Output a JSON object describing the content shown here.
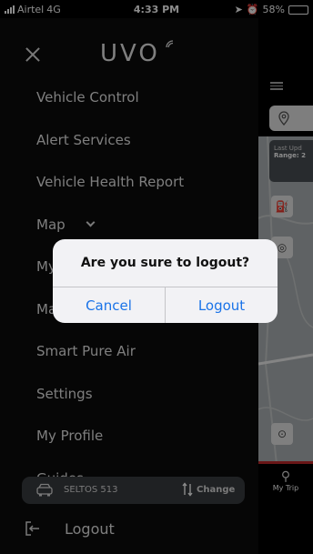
{
  "status_bar": {
    "carrier": "Airtel",
    "network": "4G",
    "time": "4:33 PM",
    "battery": "58%",
    "battery_level": 0.58
  },
  "header": {
    "logo_text": "UVO"
  },
  "menu": {
    "items": [
      {
        "label": "Vehicle Control"
      },
      {
        "label": "Alert Services"
      },
      {
        "label": "Vehicle Health Report"
      },
      {
        "label": "Map"
      },
      {
        "label": "My Trips"
      },
      {
        "label": "Manuals"
      },
      {
        "label": "Smart Pure Air"
      },
      {
        "label": "Settings"
      },
      {
        "label": "My Profile"
      },
      {
        "label": "Guides"
      }
    ]
  },
  "vehicle": {
    "name": "SELTOS 513",
    "change_label": "Change"
  },
  "logout_label": "Logout",
  "map_panel": {
    "update_text": "Last Upd",
    "range_text": "Range: 2",
    "mytrip_label": "My Trip"
  },
  "dialog": {
    "title": "Are you sure to logout?",
    "cancel_label": "Cancel",
    "confirm_label": "Logout"
  },
  "colors": {
    "accent": "#1a73e8",
    "background": "#000000",
    "panel": "#3a3d41"
  }
}
